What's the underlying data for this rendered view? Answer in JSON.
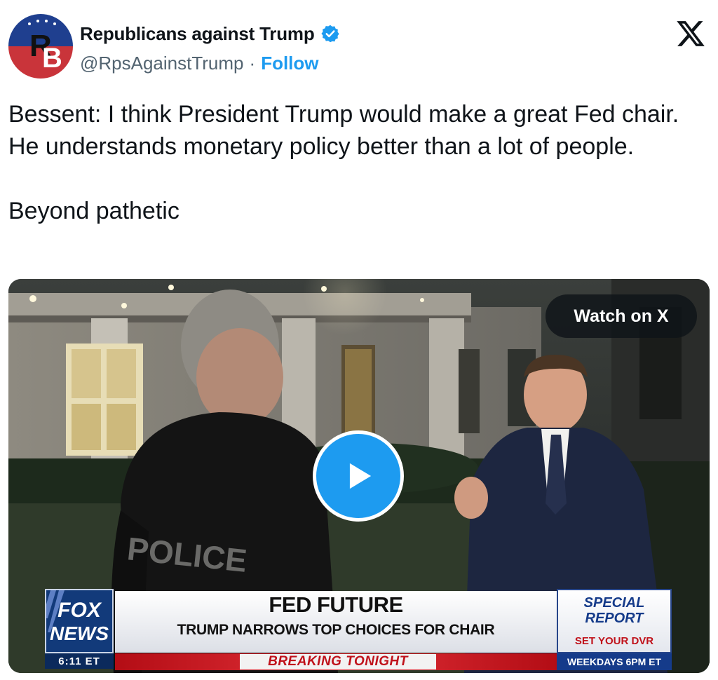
{
  "author": {
    "display_name": "Republicans against Trump",
    "handle": "@RpsAgainstTrump",
    "separator": "·",
    "follow_label": "Follow",
    "avatar_text": "RB"
  },
  "tweet": {
    "paragraphs": [
      "Bessent: I think President Trump would make a great Fed chair. He understands monetary policy better than a lot of people.",
      "Beyond pathetic"
    ]
  },
  "media": {
    "watch_label": "Watch on X",
    "jacket_text": "POLICE",
    "lower_third": {
      "network_line1": "FOX",
      "network_line2": "NEWS",
      "time": "6:11 ET",
      "headline": "FED FUTURE",
      "subhead": "TRUMP NARROWS TOP CHOICES FOR CHAIR",
      "breaking": "BREAKING TONIGHT",
      "show_line1": "SPECIAL",
      "show_line2": "REPORT",
      "dvr": "SET YOUR DVR",
      "schedule": "WEEKDAYS 6PM ET"
    }
  },
  "icons": {
    "verified": "verified-badge-icon",
    "x_logo": "x-logo-icon",
    "play": "play-icon"
  },
  "colors": {
    "accent": "#1d9bf0",
    "text": "#0f1419",
    "secondary": "#536471",
    "fox_red": "#c0121b",
    "fox_blue": "#153b8a"
  }
}
